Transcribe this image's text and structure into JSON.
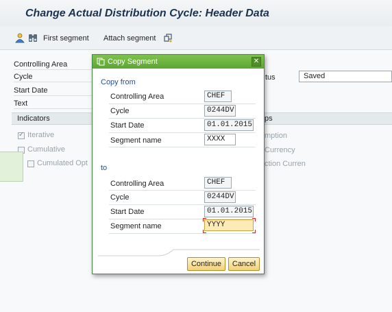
{
  "window": {
    "title": "Change Actual Distribution Cycle: Header Data"
  },
  "toolbar": {
    "icons": [
      "person-icon",
      "binoculars-icon",
      "attach-icon"
    ],
    "first_segment": "First segment",
    "attach_segment": "Attach segment"
  },
  "header_form": {
    "controlling_area_label": "Controlling Area",
    "cycle_label": "Cycle",
    "start_date_label": "Start Date",
    "text_label": "Text",
    "status_label": "tus",
    "status_value": "Saved"
  },
  "indicators": {
    "label": "Indicators",
    "groups_label": "ps",
    "iterative": {
      "label": "Iterative",
      "checked": true
    },
    "cumulative": {
      "label": "Cumulative",
      "checked": false
    },
    "cumulated_opt": {
      "label": "Cumulated Opt",
      "checked": false
    },
    "right_options": [
      "mption",
      "Currency",
      "ction Curren"
    ]
  },
  "dialog": {
    "title": "Copy Segment",
    "copy_from": {
      "heading": "Copy from",
      "controlling_area_label": "Controlling Area",
      "controlling_area": "CHEF",
      "cycle_label": "Cycle",
      "cycle": "0244DV",
      "start_date_label": "Start Date",
      "start_date": "01.01.2015",
      "segment_name_label": "Segment name",
      "segment_name": "XXXX"
    },
    "to": {
      "heading": "to",
      "controlling_area_label": "Controlling Area",
      "controlling_area": "CHEF",
      "cycle_label": "Cycle",
      "cycle": "0244DV",
      "start_date_label": "Start Date",
      "start_date": "01.01.2015",
      "segment_name_label": "Segment name",
      "segment_name": "YYYY"
    },
    "continue_label": "Continue",
    "cancel_label": "Cancel"
  },
  "colors": {
    "title": "#1b3350",
    "dialog_header": "#6ab43d",
    "section_heading": "#1f4e9c",
    "active_field": "#fdebb7"
  }
}
